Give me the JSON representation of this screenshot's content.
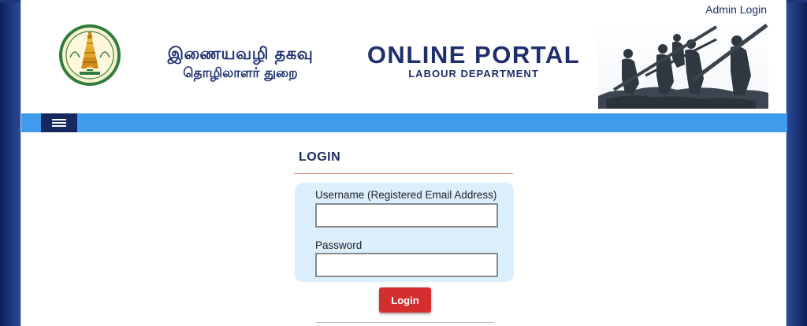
{
  "header": {
    "admin_login": "Admin Login",
    "tamil_title": "இணையவழி தகவு",
    "tamil_subtitle": "தொழிலாளர் துறை",
    "portal_title": "ONLINE PORTAL",
    "portal_subtitle": "LABOUR DEPARTMENT",
    "emblem_icon": "tamil-nadu-emblem-icon",
    "statue_image": "triumph-of-labour-statue"
  },
  "nav": {
    "menu_icon": "hamburger-menu-icon"
  },
  "login": {
    "heading": "LOGIN",
    "username_label": "Username (Registered Email Address)",
    "username_value": "",
    "password_label": "Password",
    "password_value": "",
    "button_label": "Login"
  },
  "colors": {
    "navbar": "#3f9ced",
    "menu_button": "#16295f",
    "title_text": "#1f2f6d",
    "login_button": "#d32f2f",
    "login_box": "#dcefff",
    "heading_rule": "#e18a78"
  }
}
